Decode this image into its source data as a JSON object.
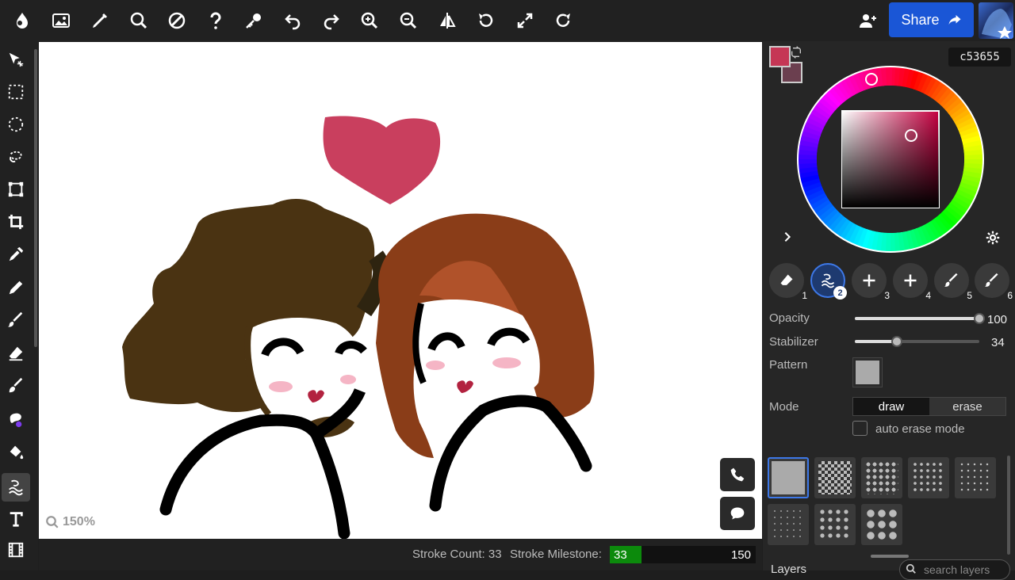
{
  "toolbar_top": {
    "icons": [
      "app-logo-icon",
      "image-icon",
      "pencil-icon",
      "search-icon",
      "contrast-icon",
      "help-icon",
      "key-icon",
      "undo-icon",
      "redo-icon",
      "zoom-in-icon",
      "zoom-out-icon",
      "flip-icon",
      "rotate-icon",
      "fullscreen-icon",
      "rotate-reset-icon"
    ],
    "share_label": "Share",
    "add_user_icon": "add-user-icon"
  },
  "tools": [
    "move",
    "rect-select",
    "ellipse-select",
    "lasso-select",
    "transform",
    "crop",
    "eyedropper",
    "pencil",
    "brush",
    "eraser",
    "blend",
    "smudge",
    "fill",
    "liquify",
    "text",
    "film"
  ],
  "canvas": {
    "zoom_label": "150%"
  },
  "status": {
    "stroke_count_label": "Stroke Count: 33",
    "milestone_label": "Stroke Milestone:",
    "milestone_value": "33",
    "milestone_max": "150",
    "milestone_fraction": 0.22
  },
  "color": {
    "hex": "c53655",
    "primary": "#c53655",
    "secondary": "#6b3f4f"
  },
  "brushes": [
    "1",
    "2",
    "3",
    "4",
    "5",
    "6"
  ],
  "opacity": {
    "label": "Opacity",
    "value": "100",
    "fraction": 1.0
  },
  "stabilizer": {
    "label": "Stabilizer",
    "value": "34",
    "fraction": 0.34
  },
  "pattern_label": "Pattern",
  "mode": {
    "label": "Mode",
    "draw": "draw",
    "erase": "erase"
  },
  "auto_erase_label": "auto erase mode",
  "layers": {
    "label": "Layers",
    "search_placeholder": "search layers"
  }
}
